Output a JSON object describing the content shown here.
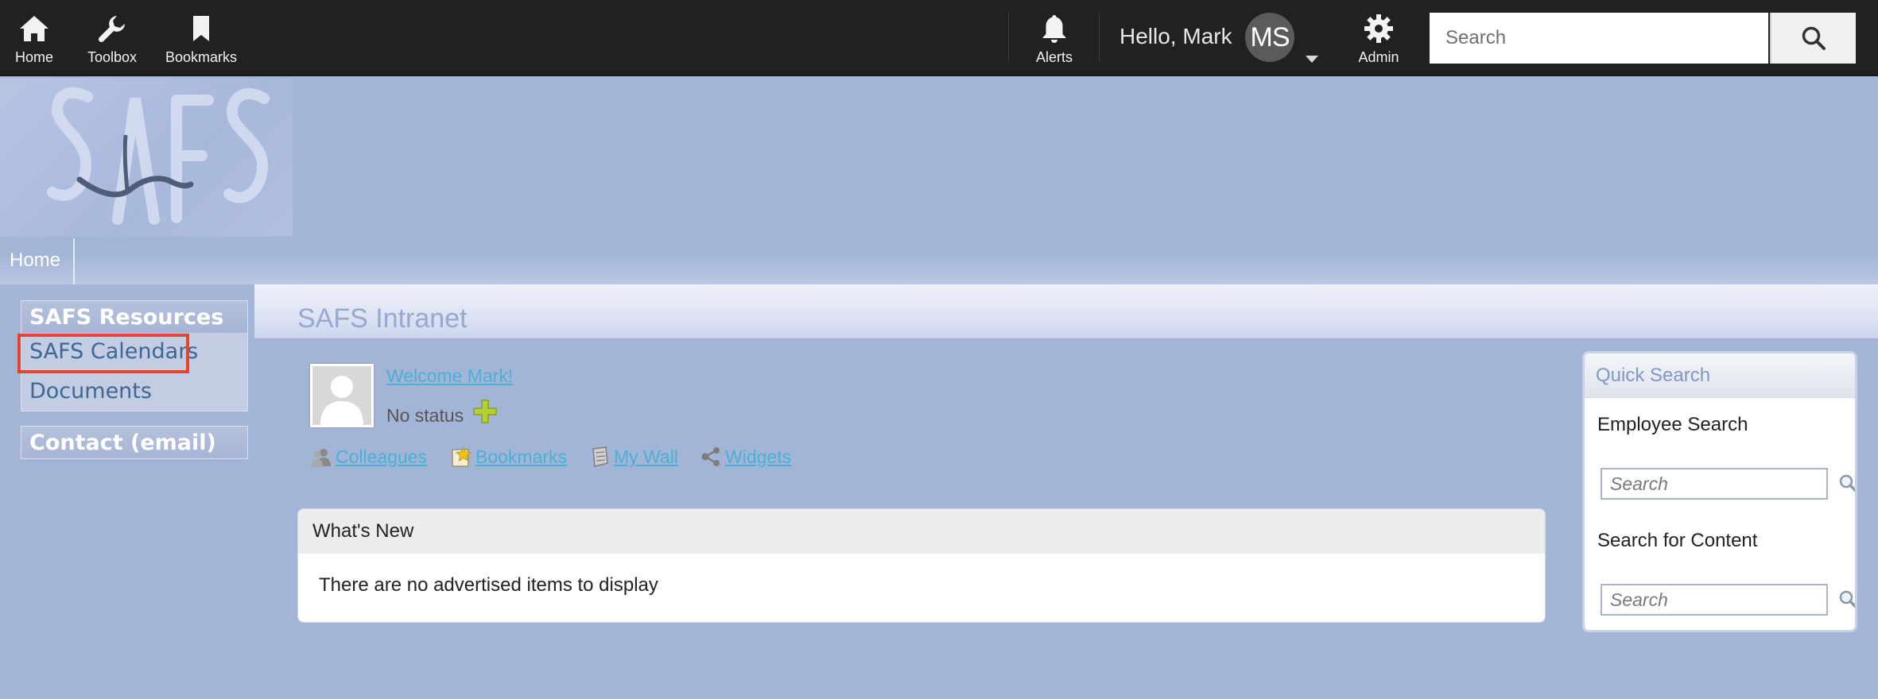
{
  "topbar": {
    "nav": [
      {
        "label": "Home",
        "icon": "home-icon"
      },
      {
        "label": "Toolbox",
        "icon": "wrench-icon"
      },
      {
        "label": "Bookmarks",
        "icon": "bookmark-icon"
      }
    ],
    "alerts_label": "Alerts",
    "greeting": "Hello, Mark",
    "avatar_initials": "MS",
    "admin_label": "Admin",
    "search_placeholder": "Search",
    "colors": {
      "bar": "#212121",
      "text": "#ffffff"
    }
  },
  "breadcrumb": {
    "home_label": "Home"
  },
  "sidebar": {
    "section_title": "SAFS Resources",
    "items": [
      {
        "label": "SAFS Calendars",
        "highlighted": true
      },
      {
        "label": "Documents"
      }
    ],
    "contact_label": "Contact (email)"
  },
  "main": {
    "title": "SAFS Intranet",
    "welcome": "Welcome Mark!",
    "status": "No status",
    "quick_links": [
      {
        "label": "Colleagues",
        "icon": "colleagues-icon"
      },
      {
        "label": "Bookmarks",
        "icon": "bookmarks-star-icon"
      },
      {
        "label": "My Wall",
        "icon": "notepad-icon"
      },
      {
        "label": "Widgets",
        "icon": "share-nodes-icon"
      }
    ],
    "whats_new": {
      "title": "What's New",
      "empty_message": "There are no advertised items to display"
    }
  },
  "quick_search": {
    "title": "Quick Search",
    "employee_label": "Employee Search",
    "employee_placeholder": "Search",
    "content_label": "Search for Content",
    "content_placeholder": "Search"
  },
  "colors": {
    "page_bg": "#a3b5d6",
    "link": "#4ab0d5",
    "sidebar_link": "#3e6791",
    "highlight": "#e2442e"
  }
}
